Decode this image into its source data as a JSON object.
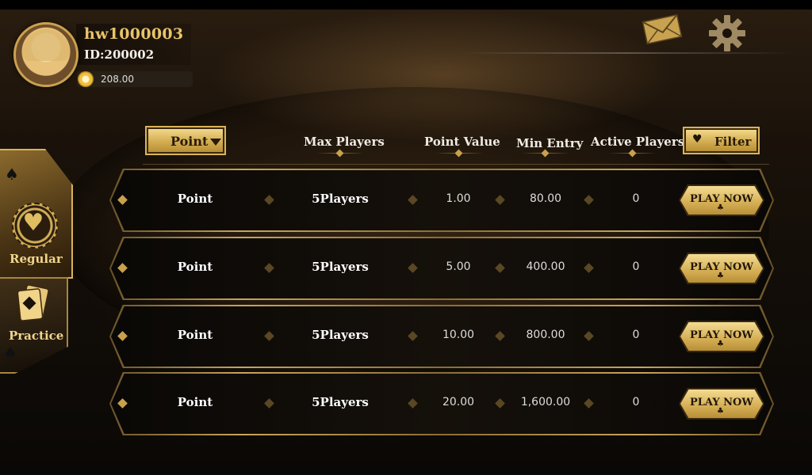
{
  "profile": {
    "username": "hw1000003",
    "user_id": "ID:200002",
    "balance": "208.00"
  },
  "top_icons": [
    "mail-icon",
    "gear-icon"
  ],
  "side_tabs": [
    {
      "label": "Regular",
      "selected": true
    },
    {
      "label": "Practice",
      "selected": false
    }
  ],
  "header": {
    "dropdown_label": "Point",
    "columns": [
      "Max Players",
      "Point Value",
      "Min Entry",
      "Active Players"
    ],
    "filter_label": "Filter"
  },
  "rows": [
    {
      "type": "Point",
      "players": "5Players",
      "point_value": "1.00",
      "min_entry": "80.00",
      "active": "0",
      "action": "PLAY NOW"
    },
    {
      "type": "Point",
      "players": "5Players",
      "point_value": "5.00",
      "min_entry": "400.00",
      "active": "0",
      "action": "PLAY NOW"
    },
    {
      "type": "Point",
      "players": "5Players",
      "point_value": "10.00",
      "min_entry": "800.00",
      "active": "0",
      "action": "PLAY NOW"
    },
    {
      "type": "Point",
      "players": "5Players",
      "point_value": "20.00",
      "min_entry": "1,600.00",
      "active": "0",
      "action": "PLAY NOW"
    }
  ],
  "colors": {
    "gold": "#d3ad52",
    "gold_light": "#f2d88a",
    "dark": "#0d0a07"
  }
}
